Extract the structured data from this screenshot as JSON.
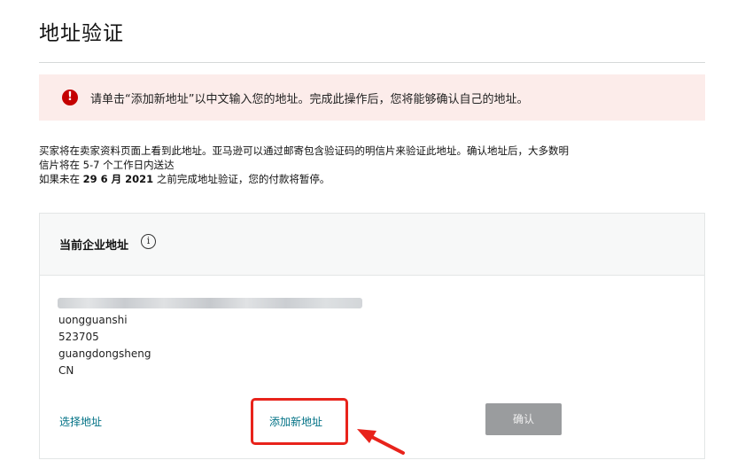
{
  "page": {
    "title": "地址验证"
  },
  "alert": {
    "icon": "exclamation-circle-icon",
    "glyph": "!",
    "text": "请单击“添加新地址”以中文输入您的地址。完成此操作后，您将能够确认自己的地址。",
    "color": "#c40000",
    "background": "#fcecea"
  },
  "info": {
    "line1": "买家将在卖家资料页面上看到此地址。亚马逊可以通过邮寄包含验证码的明信片来验证此地址。确认地址后，大多数明",
    "line2": "信片将在 5-7 个工作日内送达",
    "deadline_prefix": "如果未在",
    "deadline_date": "29 6 月 2021",
    "deadline_suffix": "之前完成地址验证，您的付款将暂停。"
  },
  "card": {
    "title": "当前企业地址",
    "info_icon": "info-icon",
    "info_glyph": "i",
    "address": {
      "city_partial": "uongguanshi",
      "postal_code": "523705",
      "province": "guangdongsheng",
      "country": "CN"
    },
    "select_address_label": "选择地址",
    "add_address_label": "添加新地址",
    "confirm_label": "确认"
  },
  "colors": {
    "link": "#007185",
    "highlight": "#e8231b",
    "button_disabled": "#9a9c9e"
  }
}
